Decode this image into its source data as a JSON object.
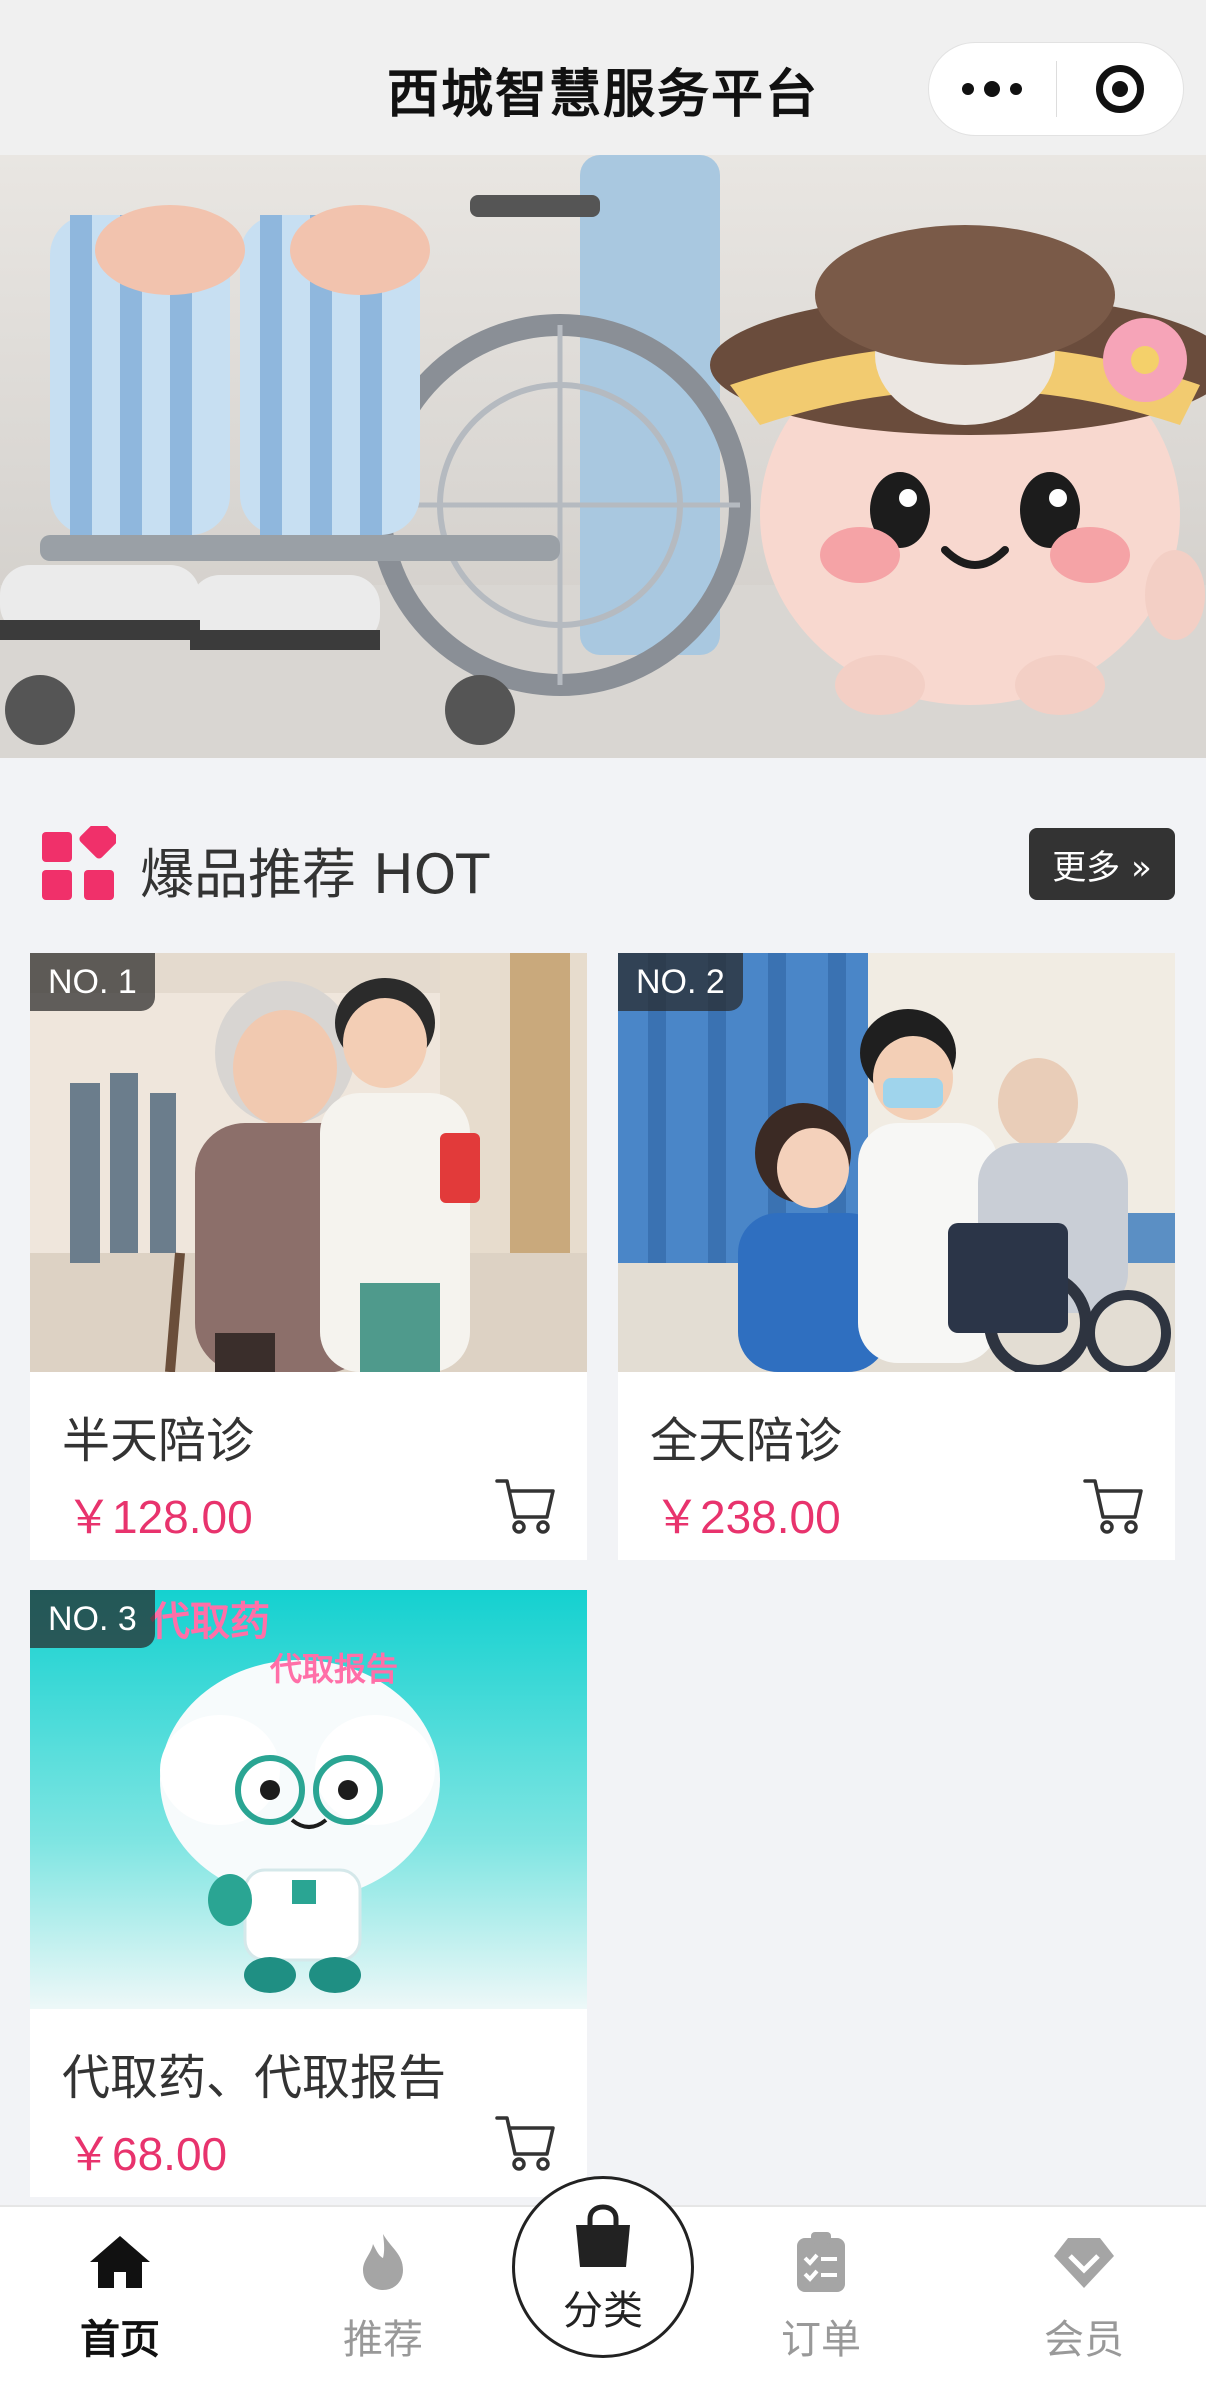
{
  "header": {
    "title": "西城智慧服务平台"
  },
  "section": {
    "title": "爆品推荐 HOT",
    "more_label": "更多 »"
  },
  "products": [
    {
      "badge": "NO. 1",
      "name": "半天陪诊",
      "price": "￥128.00"
    },
    {
      "badge": "NO. 2",
      "name": "全天陪诊",
      "price": "￥238.00"
    },
    {
      "badge": "NO. 3",
      "name": "代取药、代取报告",
      "price": "￥68.00",
      "image_text_1": "代取药",
      "image_text_2": "代取报告"
    }
  ],
  "tabbar": {
    "home": "首页",
    "recommend": "推荐",
    "category": "分类",
    "orders": "订单",
    "member": "会员"
  },
  "colors": {
    "accent": "#e8336d",
    "dark": "#333333"
  },
  "icons": [
    "more-dots-icon",
    "close-target-icon",
    "grid-category-icon",
    "cart-icon",
    "home-icon",
    "flame-icon",
    "shopping-bag-icon",
    "order-clipboard-icon",
    "diamond-member-icon"
  ]
}
